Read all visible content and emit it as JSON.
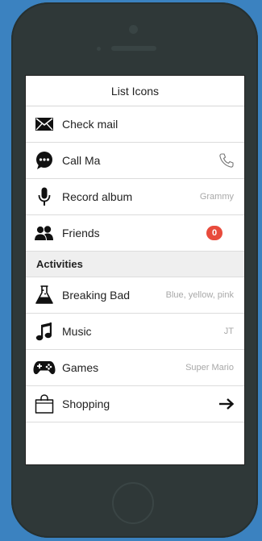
{
  "nav": {
    "title": "List Icons"
  },
  "list": {
    "check_mail": {
      "label": "Check mail",
      "icon": "envelope-icon"
    },
    "call": {
      "label": "Call Ma",
      "icon": "chat-bubble-icon",
      "accessory": "phone-icon"
    },
    "record": {
      "label": "Record album",
      "icon": "microphone-icon",
      "detail": "Grammy"
    },
    "friends": {
      "label": "Friends",
      "icon": "users-icon",
      "badge": "0",
      "badge_color": "#e84b3c"
    }
  },
  "activities": {
    "title": "Activities",
    "breaking_bad": {
      "label": "Breaking Bad",
      "icon": "flask-icon",
      "detail": "Blue, yellow, pink"
    },
    "music": {
      "label": "Music",
      "icon": "music-note-icon",
      "detail": "JT"
    },
    "games": {
      "label": "Games",
      "icon": "gamepad-icon",
      "detail": "Super Mario"
    },
    "shopping": {
      "label": "Shopping",
      "icon": "shopping-bag-icon",
      "accessory": "arrow-right-icon"
    }
  },
  "colors": {
    "background": "#3b82c0",
    "phone": "#2f3838",
    "badge": "#e84b3c"
  }
}
